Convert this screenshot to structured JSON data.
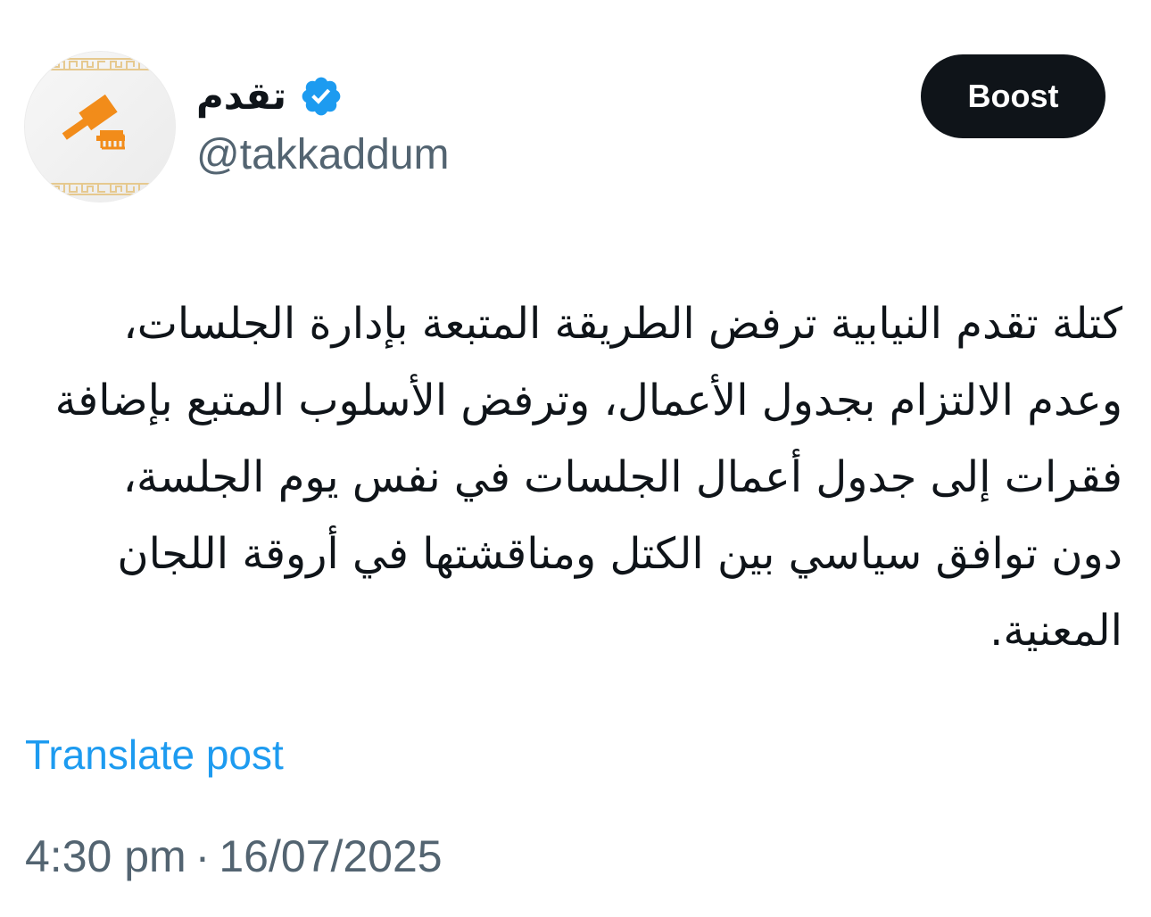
{
  "author": {
    "display_name": "تقدم",
    "handle": "@takkaddum",
    "verified": true,
    "avatar_icon": "gavel-logo-icon"
  },
  "actions": {
    "boost_label": "Boost"
  },
  "post": {
    "text": "كتلة تقدم النيابية ترفض الطريقة المتبعة بإدارة الجلسات، وعدم الالتزام بجدول الأعمال، وترفض الأسلوب المتبع بإضافة فقرات إلى جدول أعمال الجلسات في نفس يوم الجلسة، دون توافق سياسي بين الكتل ومناقشتها في أروقة اللجان المعنية.",
    "translate_label": "Translate post",
    "time": "4:30 pm",
    "separator": "·",
    "date": "16/07/2025"
  },
  "colors": {
    "text_primary": "#0f1419",
    "text_secondary": "#536471",
    "link": "#1d9bf0",
    "verified_badge": "#1d9bf0",
    "logo_orange": "#f28c1a"
  }
}
